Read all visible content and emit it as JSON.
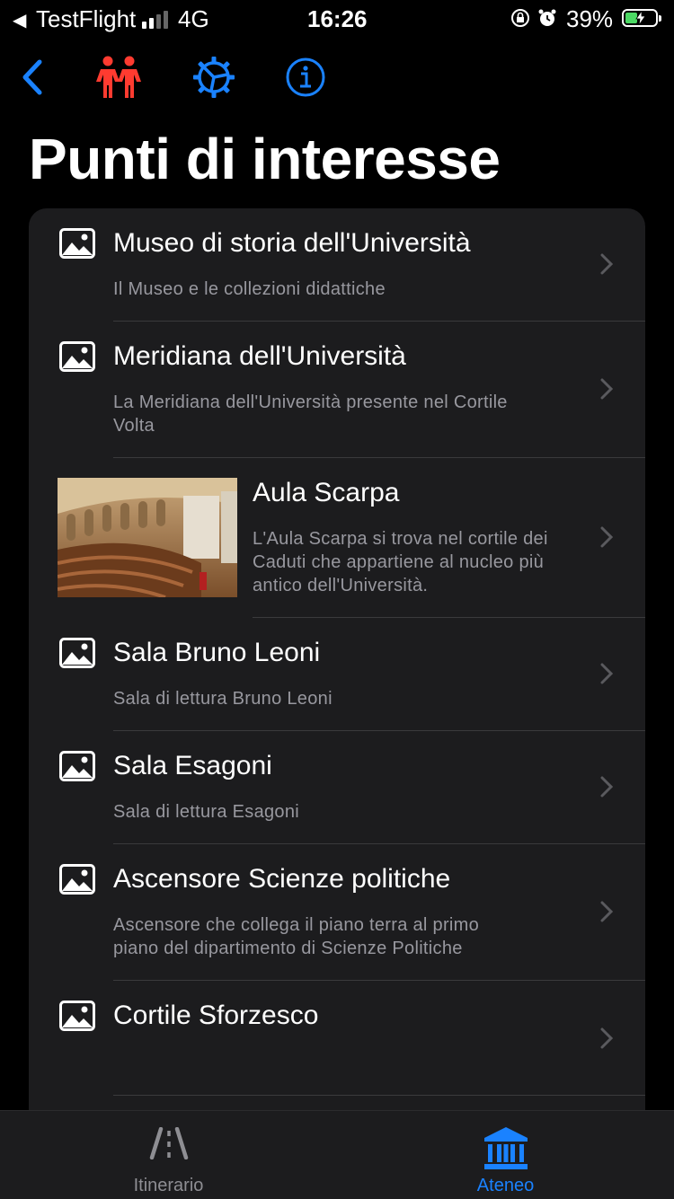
{
  "status_bar": {
    "back_app": "TestFlight",
    "network": "4G",
    "time": "16:26",
    "battery": "39%",
    "colors": {
      "battery_fill": "#4cd964"
    }
  },
  "navbar": {
    "icons": [
      "back-chevron-icon",
      "people-icon",
      "gear-icon",
      "info-icon"
    ],
    "colors": {
      "people": "#ff3b30",
      "accent": "#1a82ff"
    }
  },
  "page": {
    "title": "Punti di interesse"
  },
  "list": {
    "items": [
      {
        "title": "Museo di storia dell'Università",
        "subtitle": "Il Museo e le collezioni didattiche",
        "image": "placeholder"
      },
      {
        "title": "Meridiana dell'Università",
        "subtitle": "La Meridiana dell'Università presente nel Cortile Volta",
        "image": "placeholder"
      },
      {
        "title": "Aula Scarpa",
        "subtitle": "L'Aula Scarpa si trova nel cortile dei Caduti che appartiene al nucleo  più antico dell'Università.",
        "image": "photo"
      },
      {
        "title": "Sala Bruno Leoni",
        "subtitle": "Sala di lettura Bruno Leoni",
        "image": "placeholder"
      },
      {
        "title": "Sala Esagoni",
        "subtitle": "Sala di lettura Esagoni",
        "image": "placeholder"
      },
      {
        "title": "Ascensore Scienze politiche",
        "subtitle": "Ascensore che collega il piano terra al primo piano del dipartimento di Scienze Politiche",
        "image": "placeholder"
      },
      {
        "title": "Cortile Sforzesco",
        "subtitle": "",
        "image": "placeholder"
      }
    ]
  },
  "tabbar": {
    "tabs": [
      {
        "label": "Itinerario",
        "icon": "road-icon",
        "selected": false
      },
      {
        "label": "Ateneo",
        "icon": "institution-icon",
        "selected": true
      }
    ],
    "colors": {
      "selected": "#1a82ff",
      "unselected": "#8e8e93"
    }
  }
}
